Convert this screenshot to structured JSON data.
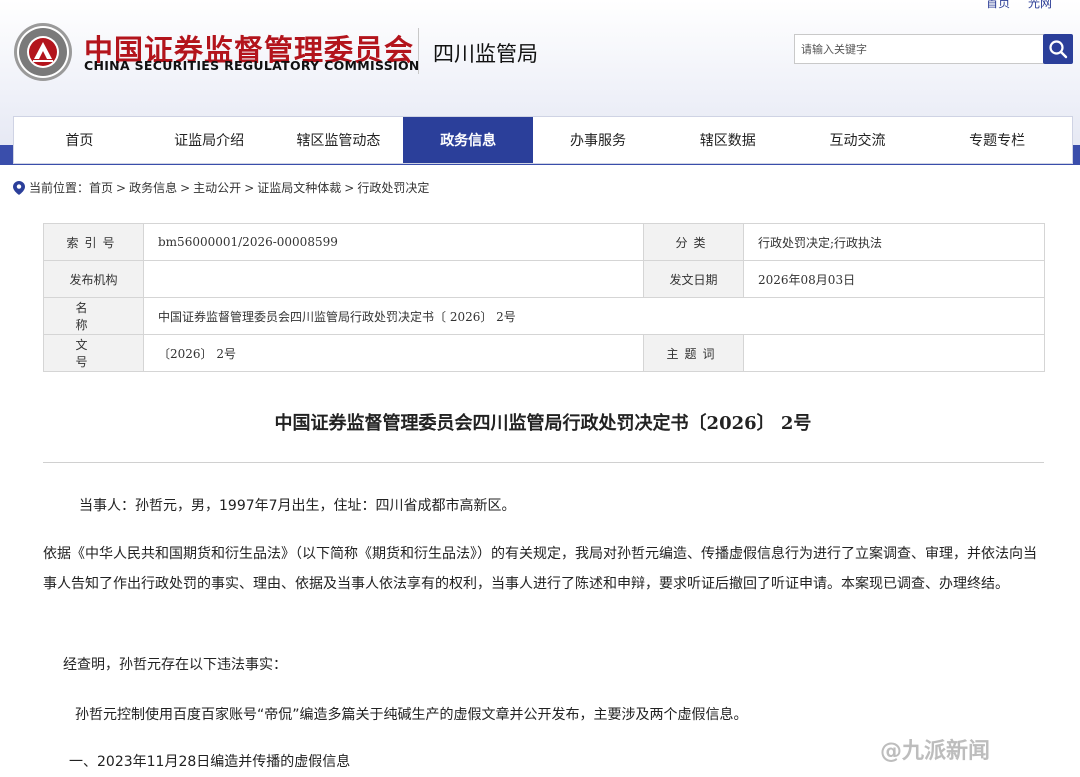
{
  "header": {
    "top_links": [
      "首页",
      "光网"
    ],
    "org_cn": "中国证券监督管理委员会",
    "org_en": "CHINA SECURITIES REGULATORY COMMISSION",
    "bureau": "四川监管局",
    "search_placeholder": "请输入关键字"
  },
  "nav": {
    "items": [
      "首页",
      "证监局介绍",
      "辖区监管动态",
      "政务信息",
      "办事服务",
      "辖区数据",
      "互动交流",
      "专题专栏"
    ],
    "active": "政务信息"
  },
  "breadcrumb": {
    "label": "当前位置：",
    "items": [
      "首页",
      "政务信息",
      "主动公开",
      "证监局文种体裁",
      "行政处罚决定"
    ],
    "separator": ">"
  },
  "meta": {
    "index_label": "索引号",
    "index_value": "bm56000001/2026-00008599",
    "category_label": "分类",
    "category_value": "行政处罚决定;行政执法",
    "publisher_label": "发布机构",
    "publisher_value": "",
    "date_label": "发文日期",
    "date_value": "2026年08月03日",
    "name_label": "名称",
    "name_value": "中国证券监督管理委员会四川监管局行政处罚决定书〔 2026〕 2号",
    "docno_label": "文号",
    "docno_value": "〔2026〕 2号",
    "keywords_label": "主题词",
    "keywords_value": ""
  },
  "doc": {
    "title": "中国证券监督管理委员会四川监管局行政处罚决定书〔2026〕 2号",
    "p1": "当事人：孙哲元，男，1997年7月出生，住址：四川省成都市高新区。",
    "p2": "依据《中华人民共和国期货和衍生品法》（以下简称《期货和衍生品法》）的有关规定，我局对孙哲元编造、传播虚假信息行为进行了立案调查、审理，并依法向当事人告知了作出行政处罚的事实、理由、依据及当事人依法享有的权利，当事人进行了陈述和申辩，要求听证后撤回了听证申请。本案现已调查、办理终结。",
    "p3": "经查明，孙哲元存在以下违法事实：",
    "p4": "孙哲元控制使用百度百家账号“帝侃”编造多篇关于纯碱生产的虚假文章并公开发布，主要涉及两个虚假信息。",
    "p5": "一、2023年11月28日编造并传播的虚假信息"
  },
  "watermark": "@九派新闻",
  "colors": {
    "brand_red": "#b3141c",
    "nav_blue": "#2b3f9a"
  }
}
